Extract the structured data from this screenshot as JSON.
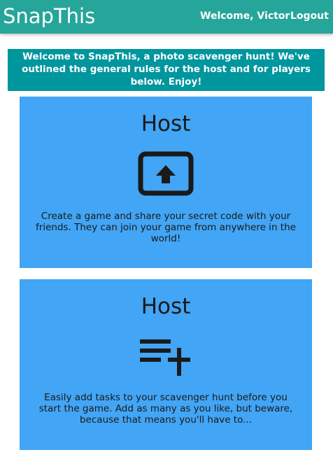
{
  "navbar": {
    "brand": "SnapThis",
    "welcome": "Welcome, Victor",
    "logout": "Logout",
    "color": "#26a69a"
  },
  "banner": {
    "text": "Welcome to SnapThis, a photo scavenger hunt! We've outlined the general rules for the host and for players below. Enjoy!",
    "color": "#00969e"
  },
  "cards": [
    {
      "title": "Host",
      "icon": "upload-screen-icon",
      "text": "Create a game and share your secret code with your friends. They can join your game from anywhere in the world!"
    },
    {
      "title": "Host",
      "icon": "playlist-add-icon",
      "text": "Easily add tasks to your scavenger hunt before you start the game. Add as many as you like, but beware, because that means you'll have to..."
    }
  ],
  "card_color": "#42a5f5"
}
